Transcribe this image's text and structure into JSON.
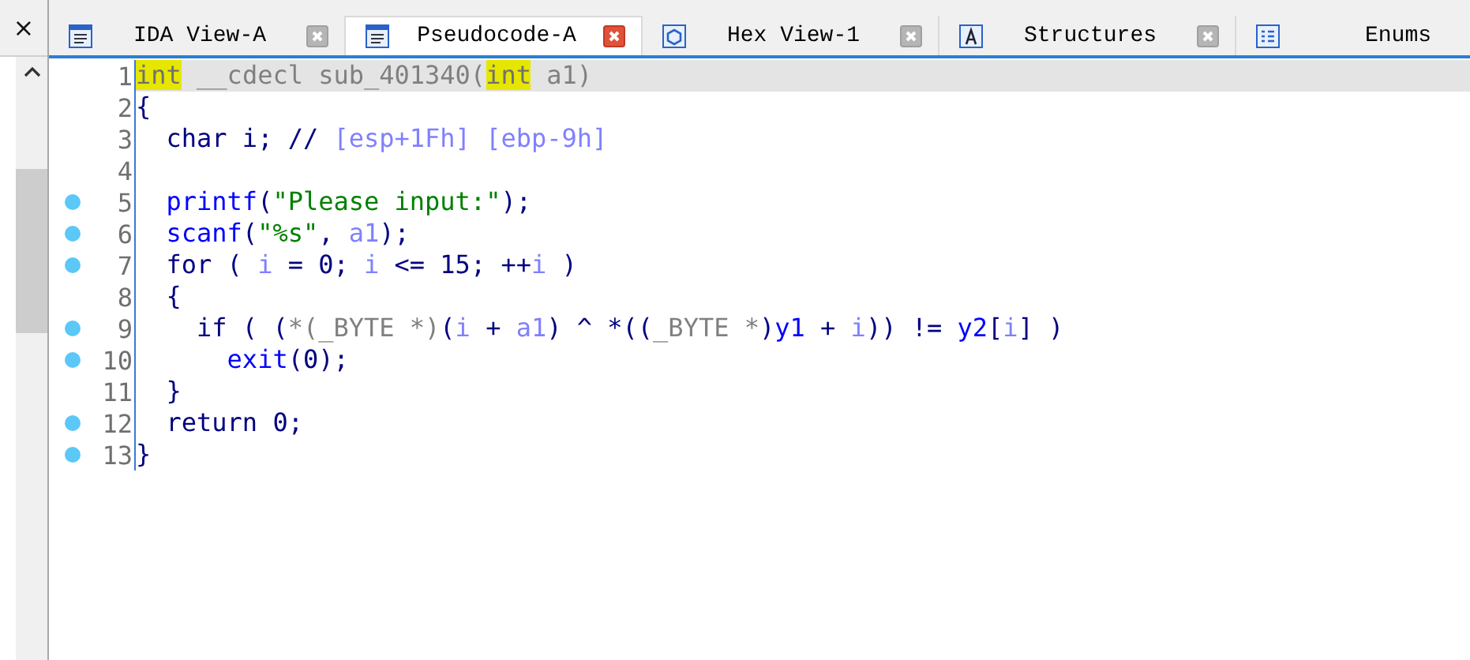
{
  "side_panel": {
    "close": "×"
  },
  "tabs": [
    {
      "label": "IDA View-A",
      "selected": false,
      "close_button": true
    },
    {
      "label": "Pseudocode-A",
      "selected": true,
      "close_button": true
    },
    {
      "label": "Hex View-1",
      "selected": false,
      "close_button": true
    },
    {
      "label": "Structures",
      "selected": false,
      "close_button": true
    },
    {
      "label": "Enums",
      "selected": false,
      "close_button": false
    }
  ],
  "lines": [
    {
      "number": "1",
      "breakpoint": false,
      "current": true,
      "tokens": [
        {
          "kind": "type",
          "text": "int"
        },
        {
          "kind": "plain",
          "text": " __cdecl sub_401340("
        },
        {
          "kind": "type",
          "text": "int"
        },
        {
          "kind": "plain",
          "text": " a1)"
        }
      ]
    },
    {
      "number": "2",
      "breakpoint": false,
      "current": false,
      "tokens": [
        {
          "kind": "keyword",
          "text": "{"
        }
      ]
    },
    {
      "number": "3",
      "breakpoint": false,
      "current": false,
      "tokens": [
        {
          "kind": "keyword",
          "text": "  char i; // "
        },
        {
          "kind": "var",
          "text": "[esp+1Fh] [ebp-9h]"
        }
      ]
    },
    {
      "number": "4",
      "breakpoint": false,
      "current": false
    },
    {
      "number": "5",
      "breakpoint": true,
      "current": false,
      "tokens": [
        {
          "kind": "func",
          "text": "  printf"
        },
        {
          "kind": "keyword",
          "text": "("
        },
        {
          "kind": "string",
          "text": "\"Please input:\""
        },
        {
          "kind": "keyword",
          "text": ");"
        }
      ]
    },
    {
      "number": "6",
      "breakpoint": true,
      "current": false,
      "tokens": [
        {
          "kind": "func",
          "text": "  scanf"
        },
        {
          "kind": "keyword",
          "text": "("
        },
        {
          "kind": "string",
          "text": "\"%s\""
        },
        {
          "kind": "keyword",
          "text": ", "
        },
        {
          "kind": "var",
          "text": "a1"
        },
        {
          "kind": "keyword",
          "text": ");"
        }
      ]
    },
    {
      "number": "7",
      "breakpoint": true,
      "current": false,
      "tokens": [
        {
          "kind": "keyword",
          "text": "  for ( "
        },
        {
          "kind": "var",
          "text": "i"
        },
        {
          "kind": "keyword",
          "text": " = 0; "
        },
        {
          "kind": "var",
          "text": "i"
        },
        {
          "kind": "keyword",
          "text": " <= 15; ++"
        },
        {
          "kind": "var",
          "text": "i"
        },
        {
          "kind": "keyword",
          "text": " )"
        }
      ]
    },
    {
      "number": "8",
      "breakpoint": false,
      "current": false,
      "tokens": [
        {
          "kind": "keyword",
          "text": "  {"
        }
      ]
    },
    {
      "number": "9",
      "breakpoint": true,
      "current": false,
      "tokens": [
        {
          "kind": "keyword",
          "text": "    if ( ("
        },
        {
          "kind": "plain",
          "text": "*(_BYTE *)"
        },
        {
          "kind": "keyword",
          "text": "("
        },
        {
          "kind": "var",
          "text": "i"
        },
        {
          "kind": "keyword",
          "text": " + "
        },
        {
          "kind": "var",
          "text": "a1"
        },
        {
          "kind": "keyword",
          "text": ") ^ *(("
        },
        {
          "kind": "plain",
          "text": "_BYTE *"
        },
        {
          "kind": "keyword",
          "text": ")"
        },
        {
          "kind": "func",
          "text": "y1"
        },
        {
          "kind": "keyword",
          "text": " + "
        },
        {
          "kind": "var",
          "text": "i"
        },
        {
          "kind": "keyword",
          "text": ")) != "
        },
        {
          "kind": "func",
          "text": "y2"
        },
        {
          "kind": "keyword",
          "text": "["
        },
        {
          "kind": "var",
          "text": "i"
        },
        {
          "kind": "keyword",
          "text": "] )"
        }
      ]
    },
    {
      "number": "10",
      "breakpoint": true,
      "current": false,
      "tokens": [
        {
          "kind": "func",
          "text": "      exit"
        },
        {
          "kind": "keyword",
          "text": "(0);"
        }
      ]
    },
    {
      "number": "11",
      "breakpoint": false,
      "current": false,
      "tokens": [
        {
          "kind": "keyword",
          "text": "  }"
        }
      ]
    },
    {
      "number": "12",
      "breakpoint": true,
      "current": false,
      "tokens": [
        {
          "kind": "keyword",
          "text": "  return 0;"
        }
      ]
    },
    {
      "number": "13",
      "breakpoint": true,
      "current": false,
      "tokens": [
        {
          "kind": "keyword",
          "text": "}"
        }
      ]
    }
  ]
}
